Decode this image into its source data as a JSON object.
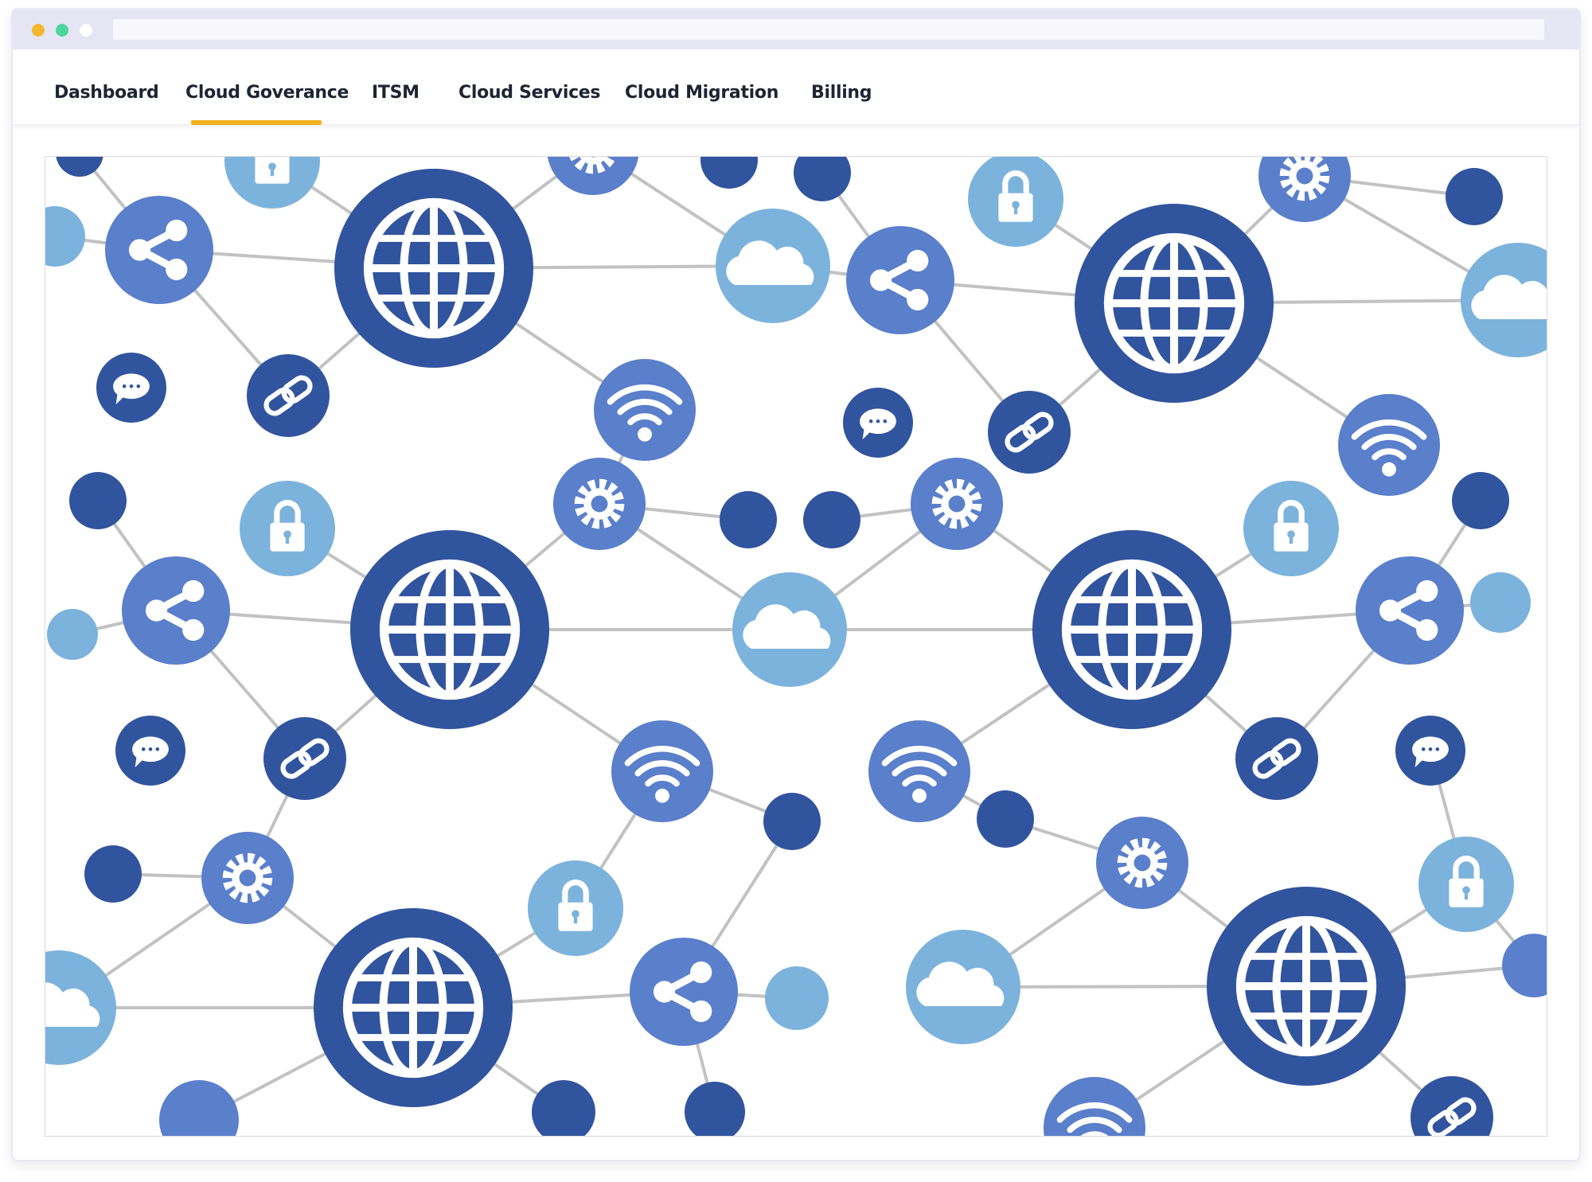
{
  "window": {
    "traffic_lights": [
      "#f5b730",
      "#4fd69c",
      "#ffffff"
    ],
    "address_bar": ""
  },
  "nav": {
    "items": [
      {
        "label": "Dashboard",
        "active": false
      },
      {
        "label": "Cloud Goverance",
        "active": true
      },
      {
        "label": "ITSM",
        "active": false
      },
      {
        "label": "Cloud Services",
        "active": false
      },
      {
        "label": "Cloud Migration",
        "active": false
      },
      {
        "label": "Billing",
        "active": false
      }
    ],
    "active_color": "#f5b01f"
  },
  "illustration": {
    "colors": {
      "navy": "#31549e",
      "mid_blue": "#5a7fcb",
      "light_blue": "#7cb3dc",
      "link_line": "#c2c2c2"
    },
    "icon_types": [
      "globe-icon",
      "share-icon",
      "link-icon",
      "cloud-icon",
      "wifi-icon",
      "gear-icon",
      "lock-icon",
      "chat-icon",
      "dot-node"
    ]
  }
}
